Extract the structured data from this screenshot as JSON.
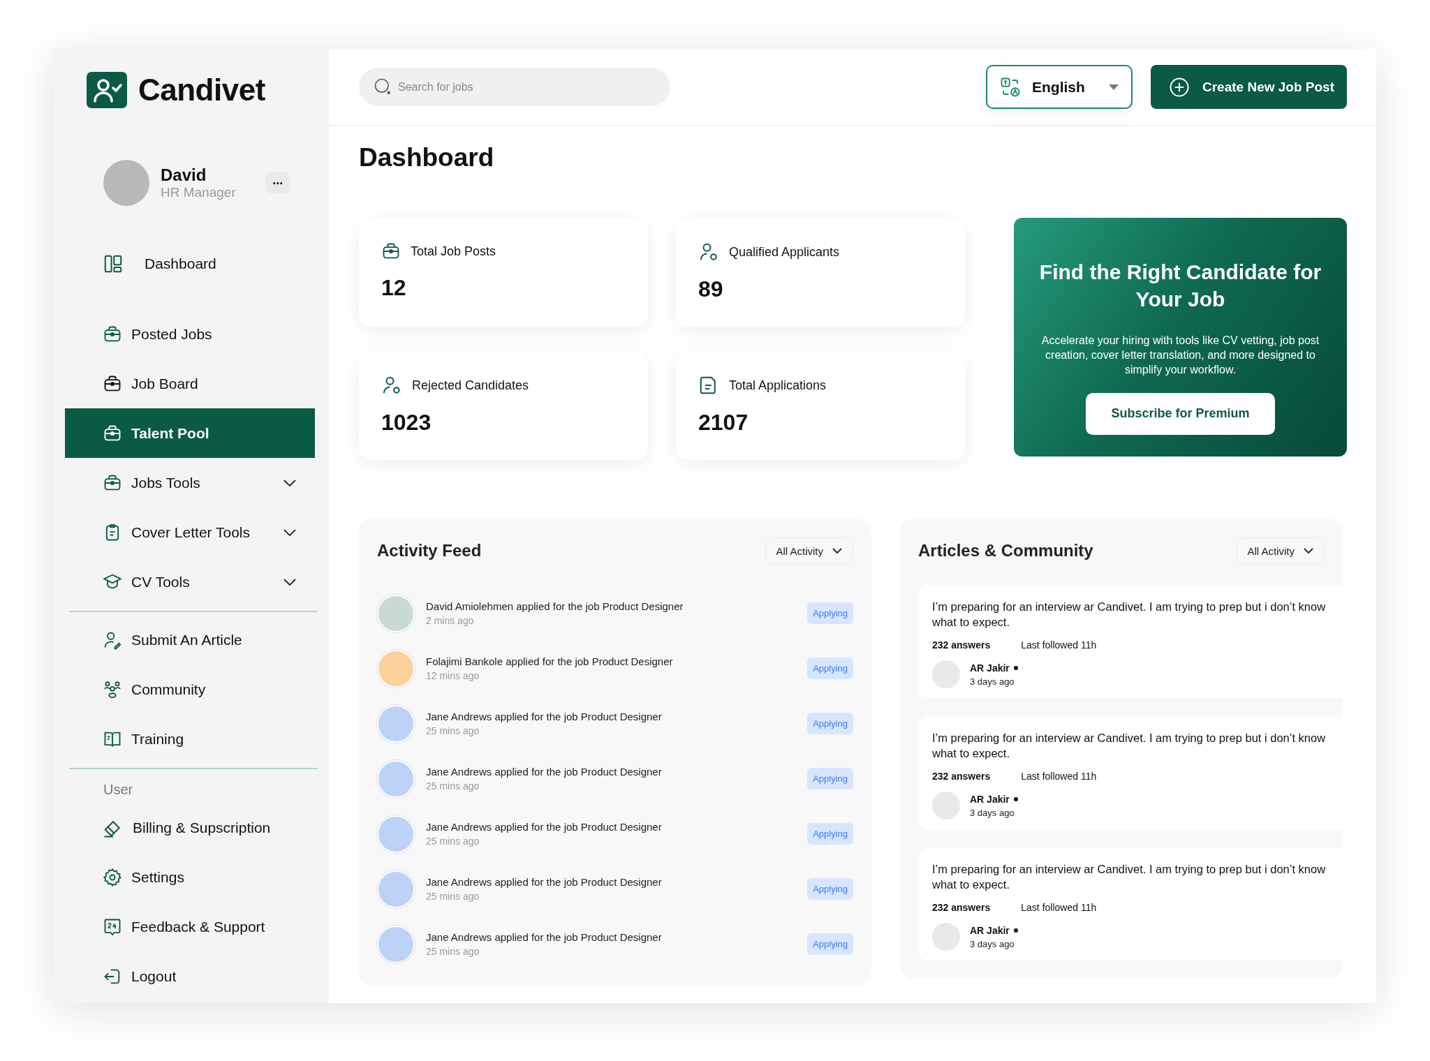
{
  "brand": {
    "name": "Candivet"
  },
  "profile": {
    "name": "David",
    "role": "HR Manager",
    "menu": "..."
  },
  "sidebar": {
    "groups": [
      {
        "items": [
          {
            "label": "Dashboard",
            "kind": "link",
            "selected": false
          },
          {
            "label": "Posted Jobs",
            "kind": "link",
            "selected": false
          },
          {
            "label": "Job Board",
            "kind": "link",
            "selected": false
          },
          {
            "label": "Talent Pool",
            "kind": "link",
            "selected": true
          },
          {
            "label": "Jobs Tools",
            "kind": "menu",
            "selected": false,
            "expanded": false
          },
          {
            "label": "Cover Letter Tools",
            "kind": "menu",
            "selected": false,
            "expanded": false
          },
          {
            "label": "CV Tools",
            "kind": "menu",
            "selected": false,
            "expanded": false
          }
        ]
      },
      {
        "items": [
          {
            "label": "Submit An Article",
            "kind": "link",
            "selected": false
          },
          {
            "label": "Community",
            "kind": "link",
            "selected": false
          },
          {
            "label": "Training",
            "kind": "link",
            "selected": false
          }
        ]
      },
      {
        "heading": "User",
        "items": [
          {
            "label": "Billing & Supscription",
            "kind": "link",
            "selected": false
          },
          {
            "label": "Settings",
            "kind": "link",
            "selected": false
          },
          {
            "label": "Feedback & Support",
            "kind": "link",
            "selected": false
          },
          {
            "label": "Logout",
            "kind": "link",
            "selected": false
          }
        ]
      }
    ]
  },
  "topbar": {
    "search": {
      "placeholder": "Search for jobs"
    },
    "language": "English",
    "create_button": "Create New Job Post"
  },
  "page_title": "Dashboard",
  "stats": [
    {
      "label": "Total Job Posts",
      "value": "12"
    },
    {
      "label": "Qualified Applicants",
      "value": "89"
    },
    {
      "label": "Rejected Candidates",
      "value": "1023"
    },
    {
      "label": "Total Applications",
      "value": "2107"
    }
  ],
  "promo": {
    "title": "Find the Right Candidate for Your Job",
    "text": "Accelerate your hiring with tools like CV vetting, job post creation, cover letter translation, and more designed to simplify your workflow.",
    "button": "Subscribe for Premium"
  },
  "activity_feed": {
    "title": "Activity Feed",
    "filter": "All Activity",
    "items": [
      {
        "text": "David Amiolehmen applied for the job Product Designer",
        "time": "2 mins ago",
        "status": "Applying",
        "color": "#c9dad2"
      },
      {
        "text": "Folajimi Bankole applied for the job Product Designer",
        "time": "12 mins ago",
        "status": "Applying",
        "color": "#fbd19a"
      },
      {
        "text": "Jane Andrews applied for the job Product Designer",
        "time": "25 mins ago",
        "status": "Applying",
        "color": "#bcd3f7"
      },
      {
        "text": "Jane Andrews applied for the job Product Designer",
        "time": "25 mins ago",
        "status": "Applying",
        "color": "#bcd3f7"
      },
      {
        "text": "Jane Andrews applied for the job Product Designer",
        "time": "25 mins ago",
        "status": "Applying",
        "color": "#bcd3f7"
      },
      {
        "text": "Jane Andrews applied for the job Product Designer",
        "time": "25 mins ago",
        "status": "Applying",
        "color": "#bcd3f7"
      },
      {
        "text": "Jane Andrews applied for the job Product Designer",
        "time": "25 mins ago",
        "status": "Applying",
        "color": "#bcd3f7"
      }
    ]
  },
  "community": {
    "title": "Articles & Community",
    "filter": "All Activity",
    "posts": [
      {
        "question": "I’m preparing for an interview ar Candivet. I am trying to prep but i don’t know what to expect.",
        "answers": "232 answers",
        "followed": "Last followed 11h",
        "author": "AR Jakir",
        "time": "3 days ago"
      },
      {
        "question": "I’m preparing for an interview ar Candivet. I am trying to prep but i don’t know what to expect.",
        "answers": "232 answers",
        "followed": "Last followed 11h",
        "author": "AR Jakir",
        "time": "3 days ago"
      },
      {
        "question": "I’m preparing for an interview ar Candivet. I am trying to prep but i don’t know what to expect.",
        "answers": "232 answers",
        "followed": "Last followed 11h",
        "author": "AR Jakir",
        "time": "3 days ago"
      }
    ]
  }
}
